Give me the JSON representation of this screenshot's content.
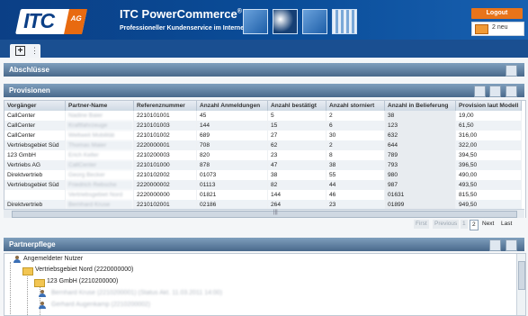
{
  "header": {
    "logo_text": "ITC",
    "logo_badge": "AG",
    "brand": "ITC PowerCommerce",
    "brand_mark": "®",
    "subtitle": "Professioneller Kundenservice im Internet",
    "logout_label": "Logout",
    "messages_label": "2 neu"
  },
  "panels": {
    "abschluesse": "Abschlüsse",
    "provisionen": "Provisionen",
    "partnerpflege": "Partnerpflege"
  },
  "table": {
    "columns": [
      "Vorgänger",
      "Partner-Name",
      "Referenznummer",
      "Anzahl Anmeldungen",
      "Anzahl bestätigt",
      "Anzahl storniert",
      "Anzahl in Belieferung",
      "Provision laut Modell"
    ],
    "rows": [
      [
        "CallCenter",
        "Nadine Baier",
        "2210101001",
        "45",
        "5",
        "2",
        "38",
        "19,00"
      ],
      [
        "CallCenter",
        "Kraftfahrzeuge",
        "2210101003",
        "144",
        "15",
        "6",
        "123",
        "61,50"
      ],
      [
        "CallCenter",
        "Weltweit Mobilität",
        "2210101002",
        "689",
        "27",
        "30",
        "632",
        "316,00"
      ],
      [
        "Vertriebsgebiet Süd",
        "Thomas Maier",
        "2220000001",
        "708",
        "62",
        "2",
        "644",
        "322,00"
      ],
      [
        "123 GmbH",
        "Erich Keller",
        "2210200003",
        "820",
        "23",
        "8",
        "789",
        "394,50"
      ],
      [
        "Vertriebs AG",
        "CallCenter",
        "2210101000",
        "878",
        "47",
        "38",
        "793",
        "396,50"
      ],
      [
        "Direktvertrieb",
        "Georg Becker",
        "2210102002",
        "01073",
        "38",
        "55",
        "980",
        "490,00"
      ],
      [
        "Vertriebsgebiet Süd",
        "Friedrich Rebsche",
        "2220000002",
        "01113",
        "82",
        "44",
        "987",
        "493,50"
      ],
      [
        "",
        "Vertriebsgebiet Nord",
        "2220000000",
        "01821",
        "144",
        "46",
        "01631",
        "815,50"
      ],
      [
        "Direktvertrieb",
        "Bernhard Kruse",
        "2210102001",
        "02186",
        "264",
        "23",
        "01899",
        "949,50"
      ]
    ]
  },
  "pager": {
    "first": "First",
    "previous": "Previous",
    "page1": "1",
    "page2": "2",
    "next": "Next",
    "last": "Last"
  },
  "tree": {
    "root": "Angemeldeter Nutzer",
    "level1": "Vertriebsgebiet Nord (2220000000)",
    "level2": "123 GmbH (2210200000)",
    "child1": "Bernhard Kruse (2210200001) (Status Akt. 11.03.2011 14:00)",
    "child2": "Gerhard Augenkamp (2210200002)"
  }
}
